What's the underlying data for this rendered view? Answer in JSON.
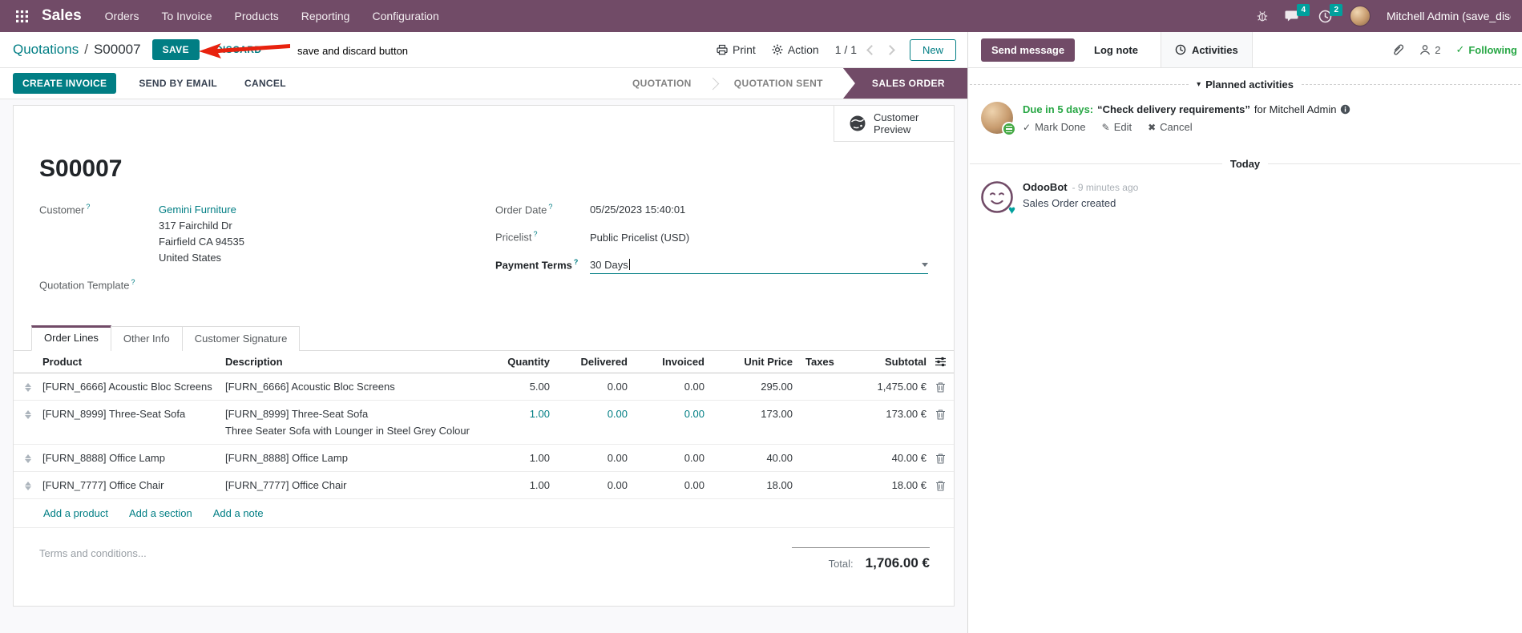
{
  "colors": {
    "primary": "#714B67",
    "accent": "#017e84",
    "badge": "#00A09D",
    "success": "#28a745",
    "annotation_red": "#e8220e"
  },
  "navbar": {
    "app": "Sales",
    "menus": {
      "orders": "Orders",
      "to_invoice": "To Invoice",
      "products": "Products",
      "reporting": "Reporting",
      "configuration": "Configuration"
    },
    "messages_badge": "4",
    "activities_badge": "2",
    "user": "Mitchell Admin (save_discard"
  },
  "control_panel": {
    "breadcrumb_parent": "Quotations",
    "breadcrumb_separator": "/",
    "breadcrumb_current": "S00007",
    "save": "SAVE",
    "discard": "DISCARD",
    "print": "Print",
    "action": "Action",
    "pager": "1 / 1",
    "new": "New"
  },
  "annotation": {
    "text": "save and discard button"
  },
  "actions_row": {
    "create_invoice": "CREATE INVOICE",
    "send_by_email": "SEND BY EMAIL",
    "cancel": "CANCEL"
  },
  "statusbar": {
    "steps": [
      {
        "label": "QUOTATION"
      },
      {
        "label": "QUOTATION SENT"
      },
      {
        "label": "SALES ORDER"
      }
    ]
  },
  "sheet": {
    "customer_preview": "Customer Preview",
    "help_marker": "?",
    "name": "S00007",
    "customer": {
      "label": "Customer",
      "name": "Gemini Furniture",
      "street": "317 Fairchild Dr",
      "city": "Fairfield CA 94535",
      "country": "United States"
    },
    "quotation_template_label": "Quotation Template",
    "order_date": {
      "label": "Order Date",
      "value": "05/25/2023 15:40:01"
    },
    "pricelist": {
      "label": "Pricelist",
      "value": "Public Pricelist (USD)"
    },
    "payment_terms": {
      "label": "Payment Terms",
      "value": "30 Days"
    },
    "tabs": {
      "order_lines": "Order Lines",
      "other_info": "Other Info",
      "customer_signature": "Customer Signature"
    },
    "table": {
      "headers": {
        "product": "Product",
        "description": "Description",
        "quantity": "Quantity",
        "delivered": "Delivered",
        "invoiced": "Invoiced",
        "unit_price": "Unit Price",
        "taxes": "Taxes",
        "subtotal": "Subtotal"
      },
      "lines": [
        {
          "product": "[FURN_6666] Acoustic Bloc Screens",
          "description": "[FURN_6666] Acoustic Bloc Screens",
          "quantity": "5.00",
          "delivered": "0.00",
          "invoiced": "0.00",
          "unit_price": "295.00",
          "subtotal": "1,475.00 €"
        },
        {
          "product": "[FURN_8999] Three-Seat Sofa",
          "description": "[FURN_8999] Three-Seat Sofa",
          "description2": "Three Seater Sofa with Lounger in Steel Grey Colour",
          "quantity": "1.00",
          "delivered": "0.00",
          "invoiced": "0.00",
          "unit_price": "173.00",
          "subtotal": "173.00 €"
        },
        {
          "product": "[FURN_8888] Office Lamp",
          "description": "[FURN_8888] Office Lamp",
          "quantity": "1.00",
          "delivered": "0.00",
          "invoiced": "0.00",
          "unit_price": "40.00",
          "subtotal": "40.00 €"
        },
        {
          "product": "[FURN_7777] Office Chair",
          "description": "[FURN_7777] Office Chair",
          "quantity": "1.00",
          "delivered": "0.00",
          "invoiced": "0.00",
          "unit_price": "18.00",
          "subtotal": "18.00 €"
        }
      ],
      "add_product": "Add a product",
      "add_section": "Add a section",
      "add_note": "Add a note"
    },
    "terms_placeholder": "Terms and conditions...",
    "total": {
      "label": "Total:",
      "value": "1,706.00 €"
    }
  },
  "chatter": {
    "send_message": "Send message",
    "log_note": "Log note",
    "activities_tab": "Activities",
    "followers_count": "2",
    "following": "Following",
    "planned_title": "Planned activities",
    "activity": {
      "due": "Due in 5 days:",
      "summary": "“Check delivery requirements”",
      "assignee": "for Mitchell Admin",
      "mark_done": "Mark Done",
      "edit": "Edit",
      "cancel": "Cancel"
    },
    "today": "Today",
    "message": {
      "author": "OdooBot",
      "timestamp": "- 9 minutes ago",
      "body": "Sales Order created"
    }
  }
}
